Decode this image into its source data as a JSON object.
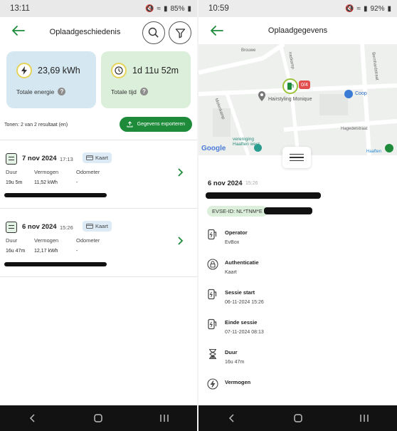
{
  "left": {
    "status": {
      "time": "13:11",
      "battery": "85%"
    },
    "title": "Oplaadgeschiedenis",
    "energy": {
      "value": "23,69 kWh",
      "label": "Totale energie"
    },
    "time": {
      "value": "1d 11u 52m",
      "label": "Totale tijd"
    },
    "results": "Tonen: 2 van 2 resultaat (en)",
    "export_label": "Gegevens exporteren",
    "columns": [
      "Duur",
      "Vermogen",
      "Odometer"
    ],
    "sessions": [
      {
        "date": "7 nov 2024",
        "time": "17:13",
        "badge": "Kaart",
        "duur": "19u 5m",
        "vermogen": "11,52 kWh",
        "odometer": "-"
      },
      {
        "date": "6 nov 2024",
        "time": "15:26",
        "badge": "Kaart",
        "duur": "16u 47m",
        "vermogen": "12,17 kWh",
        "odometer": "-"
      }
    ]
  },
  "right": {
    "status": {
      "time": "10:59",
      "battery": "92%"
    },
    "title": "Oplaadgegevens",
    "map": {
      "streets": [
        "Brouwe",
        "naskamp",
        "Bernhardstraat",
        "Molenkamp",
        "Hagedelstraat",
        "Haaften"
      ],
      "poi": "Hairstyling Monique",
      "poi2": "Coop",
      "poi3": "vereniging\nHaaften west",
      "marker_count": "0/4",
      "google": "Google"
    },
    "date": "6 nov 2024",
    "time": "15:26",
    "evse": "EVSE-ID: NL*TNM*E",
    "details": [
      {
        "label": "Operator",
        "value": "EvBox",
        "icon": "charger-icon"
      },
      {
        "label": "Authenticatie",
        "value": "Kaart",
        "icon": "lock-icon"
      },
      {
        "label": "Sessie start",
        "value": "06-11-2024 15:26",
        "icon": "charger-icon"
      },
      {
        "label": "Einde sessie",
        "value": "07-11-2024 08:13",
        "icon": "charger-icon"
      },
      {
        "label": "Duur",
        "value": "16u 47m",
        "icon": "hourglass-icon"
      },
      {
        "label": "Vermogen",
        "value": "",
        "icon": "bolt-icon"
      }
    ]
  },
  "colors": {
    "accent": "#1e8b3a",
    "energy_card": "#d5e8f1",
    "time_card": "#dcefdb"
  }
}
